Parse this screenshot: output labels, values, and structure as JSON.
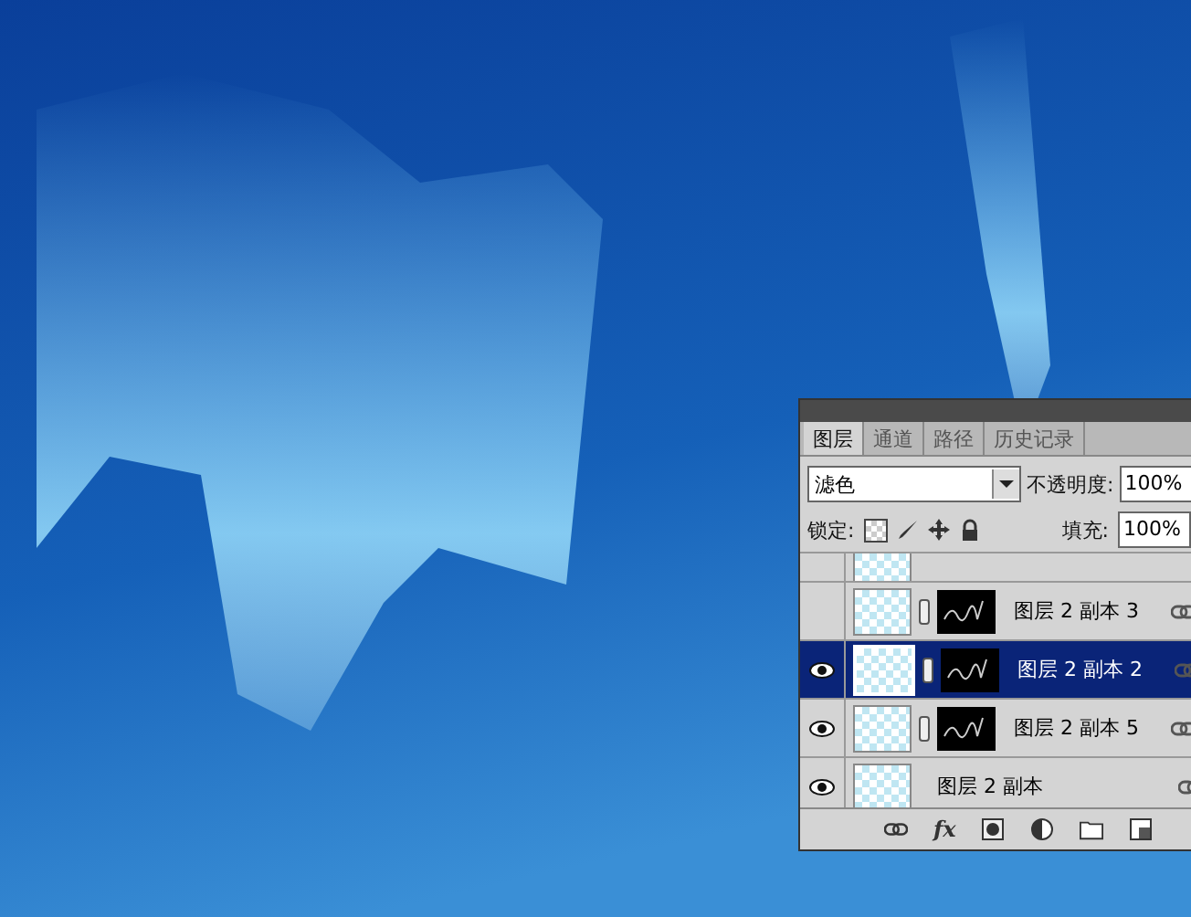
{
  "layers_panel": {
    "tabs": [
      {
        "label": "图层",
        "selected": true
      },
      {
        "label": "通道",
        "selected": false
      },
      {
        "label": "路径",
        "selected": false
      },
      {
        "label": "历史记录",
        "selected": false
      }
    ],
    "blend_mode": "滤色",
    "opacity_label": "不透明度:",
    "opacity_value": "100%",
    "lock_label": "锁定:",
    "fill_label": "填充:",
    "fill_value": "100%",
    "layers": [
      {
        "name": "图层 2 副本 3",
        "visible": false,
        "selected": false,
        "has_mask": true
      },
      {
        "name": "图层 2 副本 2",
        "visible": true,
        "selected": true,
        "has_mask": true
      },
      {
        "name": "图层 2 副本 5",
        "visible": true,
        "selected": false,
        "has_mask": true
      },
      {
        "name": "图层 2 副本",
        "visible": true,
        "selected": false,
        "has_mask": false
      }
    ],
    "fx_label": "fx"
  }
}
